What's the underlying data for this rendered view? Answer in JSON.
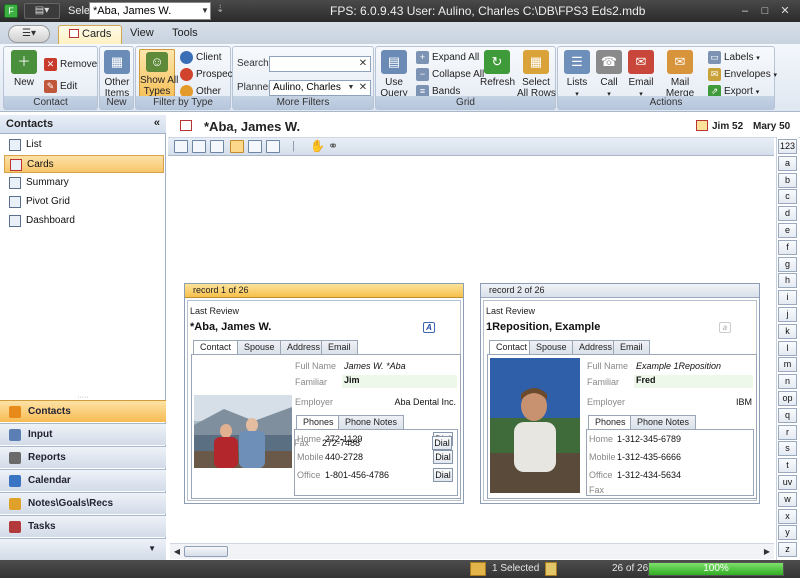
{
  "titlebar": {
    "qat_icon": "app-menu-glyph",
    "select_label": "Select",
    "select_value": "*Aba, James W.",
    "caption": "FPS: 6.0.9.43   User: Aulino, Charles   C:\\DB\\FPS3 Eds2.mdb",
    "window_buttons": [
      "–",
      "□",
      "✕"
    ]
  },
  "ribbon": {
    "tabs": [
      "Cards",
      "View",
      "Tools"
    ],
    "active_tab": "Cards",
    "groups": {
      "contact": {
        "label": "Contact",
        "new": "New",
        "remove": "Remove",
        "edit": "Edit"
      },
      "new": {
        "label": "New",
        "other_items": "Other\nItems"
      },
      "filter": {
        "label": "Filter by Type",
        "show_all": "Show All\nTypes",
        "client": "Client",
        "prospect": "Prospect",
        "other": "Other"
      },
      "more_filters": {
        "label": "More Filters",
        "search_label": "Search",
        "search_value": "",
        "planner_label": "Planner",
        "planner_value": "Aulino, Charles"
      },
      "grid": {
        "label": "Grid",
        "use_query": "Use\nQuery",
        "expand_all": "Expand All",
        "collapse_all": "Collapse All",
        "bands": "Bands",
        "refresh": "Refresh",
        "select_all_rows": "Select\nAll Rows"
      },
      "actions": {
        "label": "Actions",
        "lists": "Lists",
        "call": "Call",
        "email": "Email",
        "mail_merge": "Mail Merge",
        "labels": "Labels",
        "envelopes": "Envelopes",
        "export": "Export"
      }
    }
  },
  "sidebar": {
    "title": "Contacts",
    "items": [
      {
        "label": "List",
        "icon": "list-icon"
      },
      {
        "label": "Cards",
        "icon": "cards-icon"
      },
      {
        "label": "Summary",
        "icon": "summary-icon"
      },
      {
        "label": "Pivot Grid",
        "icon": "pivot-grid-icon"
      },
      {
        "label": "Dashboard",
        "icon": "dashboard-icon"
      }
    ],
    "active_item": "Cards",
    "nav": [
      {
        "label": "Contacts",
        "color": "#e88a1a"
      },
      {
        "label": "Input",
        "color": "#5b7fb5"
      },
      {
        "label": "Reports",
        "color": "#6a6a6a"
      },
      {
        "label": "Calendar",
        "color": "#3a75c4"
      },
      {
        "label": "Notes\\Goals\\Recs",
        "color": "#e0a12a"
      },
      {
        "label": "Tasks",
        "color": "#b23a3a"
      }
    ]
  },
  "record_header": {
    "name": "*Aba, James W.",
    "person1": "Jim 52",
    "person2": "Mary 50"
  },
  "cards": [
    {
      "record_label": "record 1 of 26",
      "last_review": "Last Review",
      "name": "*Aba, James W.",
      "tabs": [
        "Contact",
        "Spouse",
        "Address",
        "Email"
      ],
      "full_name_label": "Full Name",
      "full_name": "James W. *Aba",
      "familiar_label": "Familiar",
      "familiar": "Jim",
      "employer_label": "Employer",
      "employer": "Aba Dental Inc.",
      "phone_tabs": [
        "Phones",
        "Phone Notes"
      ],
      "phones": [
        {
          "label": "Home",
          "value": "272-1129",
          "dial": "Dial"
        },
        {
          "label": "Mobile",
          "value": "440-2728",
          "dial": "Dial"
        },
        {
          "label": "Office",
          "value": "1-801-456-4786",
          "dial": "Dial"
        },
        {
          "label": "Fax",
          "value": "272-7488",
          "dial": "Dial"
        }
      ]
    },
    {
      "record_label": "record 2 of 26",
      "last_review": "Last Review",
      "name": "1Reposition, Example",
      "tabs": [
        "Contact",
        "Spouse",
        "Address",
        "Email"
      ],
      "full_name_label": "Full Name",
      "full_name": "Example 1Reposition",
      "familiar_label": "Familiar",
      "familiar": "Fred",
      "employer_label": "Employer",
      "employer": "IBM",
      "phone_tabs": [
        "Phones",
        "Phone Notes"
      ],
      "phones": [
        {
          "label": "Home",
          "value": "1-312-345-6789"
        },
        {
          "label": "Mobile",
          "value": "1-312-435-6666"
        },
        {
          "label": "Office",
          "value": "1-312-434-5634"
        },
        {
          "label": "Fax",
          "value": ""
        }
      ]
    }
  ],
  "alpha_index": [
    "123",
    "a",
    "b",
    "c",
    "d",
    "e",
    "f",
    "g",
    "h",
    "i",
    "j",
    "k",
    "l",
    "m",
    "n",
    "op",
    "q",
    "r",
    "s",
    "t",
    "uv",
    "w",
    "x",
    "y",
    "z"
  ],
  "status": {
    "selected": "1 Selected",
    "count": "26 of 26",
    "progress_text": "100%",
    "progress_fraction": 1.0
  },
  "colors": {
    "accent_orange": "#f7c04c",
    "ribbon_blue": "#c6d3e4",
    "progress_green": "#2fae23"
  }
}
